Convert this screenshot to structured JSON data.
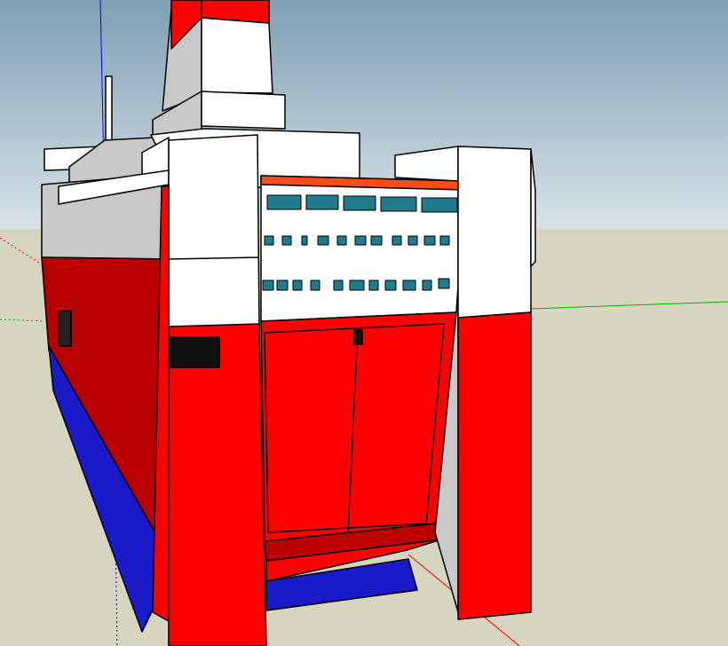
{
  "app": {
    "title": ""
  },
  "viewport": {
    "mode": "3d-model-view",
    "model": "ferry-stern"
  },
  "colors": {
    "sky_top": "#7f9fb4",
    "sky_bottom": "#dce6ea",
    "ground": "#d6d5c0",
    "hull_red": "#ff0000",
    "hull_red_shadow": "#b80000",
    "hull_blue": "#1a1ac8",
    "superstructure_white": "#ffffff",
    "superstructure_grey": "#c8c8c8",
    "window_teal": "#1f7c8c",
    "accent_orange": "#ff4d1a",
    "axis_blue": "#0000ff",
    "axis_green": "#00b000",
    "axis_red": "#ff0000",
    "edge": "#000000"
  },
  "axes": {
    "blue": "z-axis",
    "green": "y-axis",
    "red": "x-axis"
  }
}
